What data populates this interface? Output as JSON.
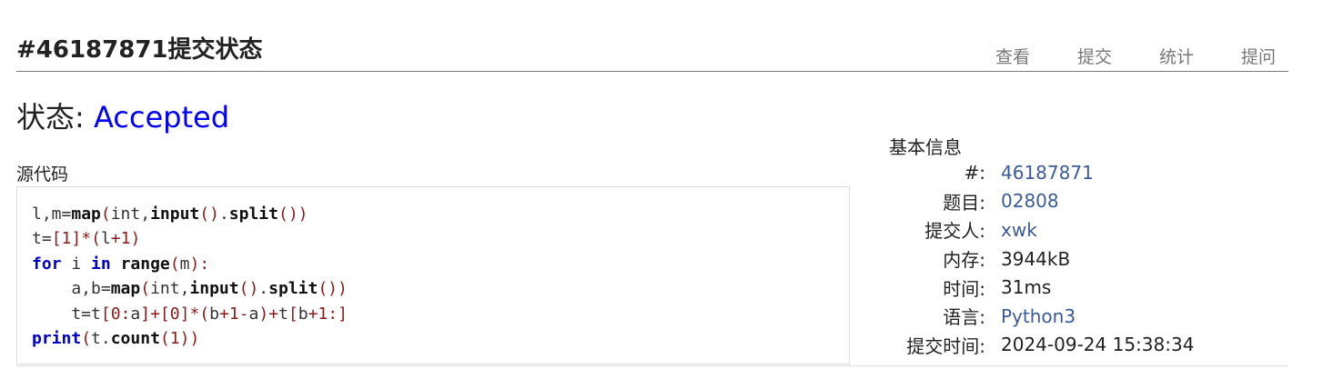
{
  "header": {
    "title": "#46187871提交状态",
    "nav": [
      "查看",
      "提交",
      "统计",
      "提问"
    ]
  },
  "status": {
    "label": "状态: ",
    "value": "Accepted"
  },
  "source": {
    "label": "源代码",
    "code_lines": [
      "l,m=map(int,input().split())",
      "t=[1]*(l+1)",
      "for i in range(m):",
      "    a,b=map(int,input().split())",
      "    t=t[0:a]+[0]*(b+1-a)+t[b+1:]",
      "print(t.count(1))"
    ]
  },
  "info": {
    "title": "基本信息",
    "rows": [
      {
        "key": "#:",
        "value": "46187871",
        "link": true
      },
      {
        "key": "题目:",
        "value": "02808",
        "link": true
      },
      {
        "key": "提交人:",
        "value": "xwk",
        "link": true
      },
      {
        "key": "内存:",
        "value": "3944kB",
        "link": false
      },
      {
        "key": "时间:",
        "value": "31ms",
        "link": false
      },
      {
        "key": "语言:",
        "value": "Python3",
        "link": true
      },
      {
        "key": "提交时间:",
        "value": "2024-09-24 15:38:34",
        "link": false
      }
    ]
  },
  "colors": {
    "accepted": "#0000ff",
    "link": "#3b5b98",
    "keyword": "#0000cc",
    "punctuation": "#8b1a1a"
  }
}
